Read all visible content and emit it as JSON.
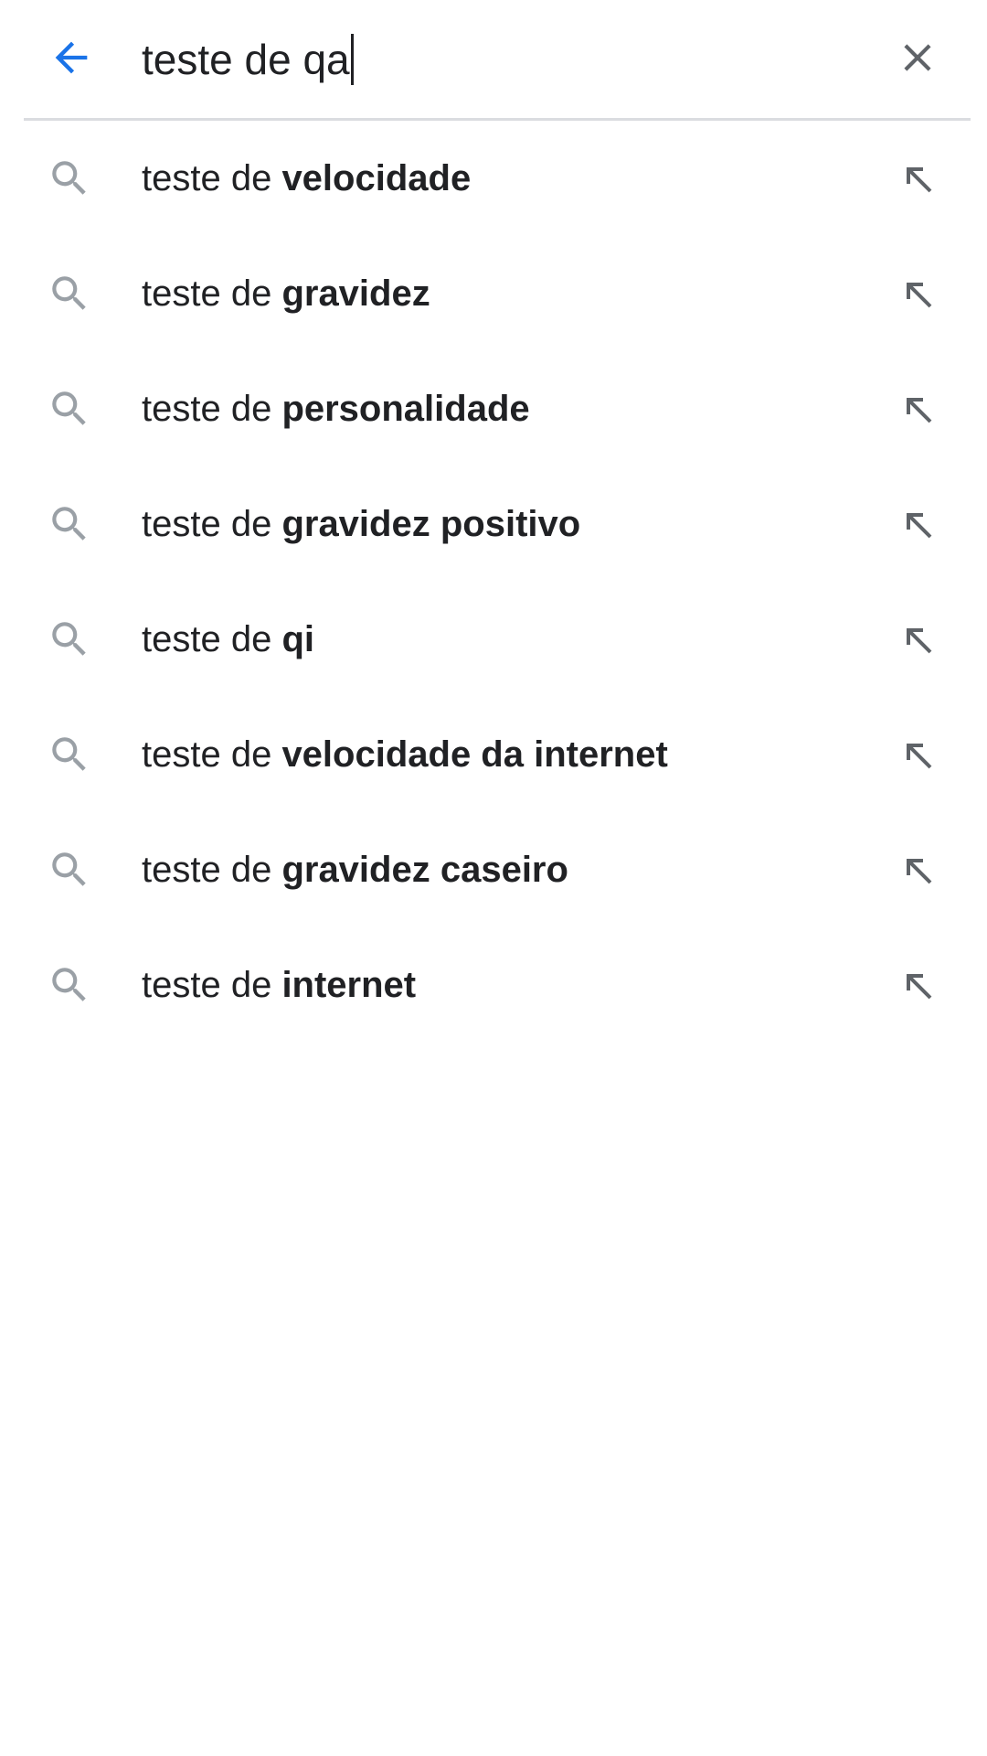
{
  "search": {
    "query": "teste de qa",
    "back_icon": "arrow-back-icon",
    "clear_icon": "close-icon"
  },
  "colors": {
    "accent": "#1a73e8",
    "text": "#202124",
    "icon_gray": "#9aa0a6",
    "clear_gray": "#5f6368",
    "divider": "#dadce0"
  },
  "suggestions": [
    {
      "prefix": "teste de ",
      "completion": "velocidade",
      "icon": "search-icon",
      "action_icon": "fill-query-arrow-icon"
    },
    {
      "prefix": "teste de ",
      "completion": "gravidez",
      "icon": "search-icon",
      "action_icon": "fill-query-arrow-icon"
    },
    {
      "prefix": "teste de ",
      "completion": "personalidade",
      "icon": "search-icon",
      "action_icon": "fill-query-arrow-icon"
    },
    {
      "prefix": "teste de ",
      "completion": "gravidez positivo",
      "icon": "search-icon",
      "action_icon": "fill-query-arrow-icon"
    },
    {
      "prefix": "teste de ",
      "completion": "qi",
      "icon": "search-icon",
      "action_icon": "fill-query-arrow-icon"
    },
    {
      "prefix": "teste de ",
      "completion": "velocidade da internet",
      "icon": "search-icon",
      "action_icon": "fill-query-arrow-icon"
    },
    {
      "prefix": "teste de ",
      "completion": "gravidez caseiro",
      "icon": "search-icon",
      "action_icon": "fill-query-arrow-icon"
    },
    {
      "prefix": "teste de ",
      "completion": "internet",
      "icon": "search-icon",
      "action_icon": "fill-query-arrow-icon"
    }
  ]
}
